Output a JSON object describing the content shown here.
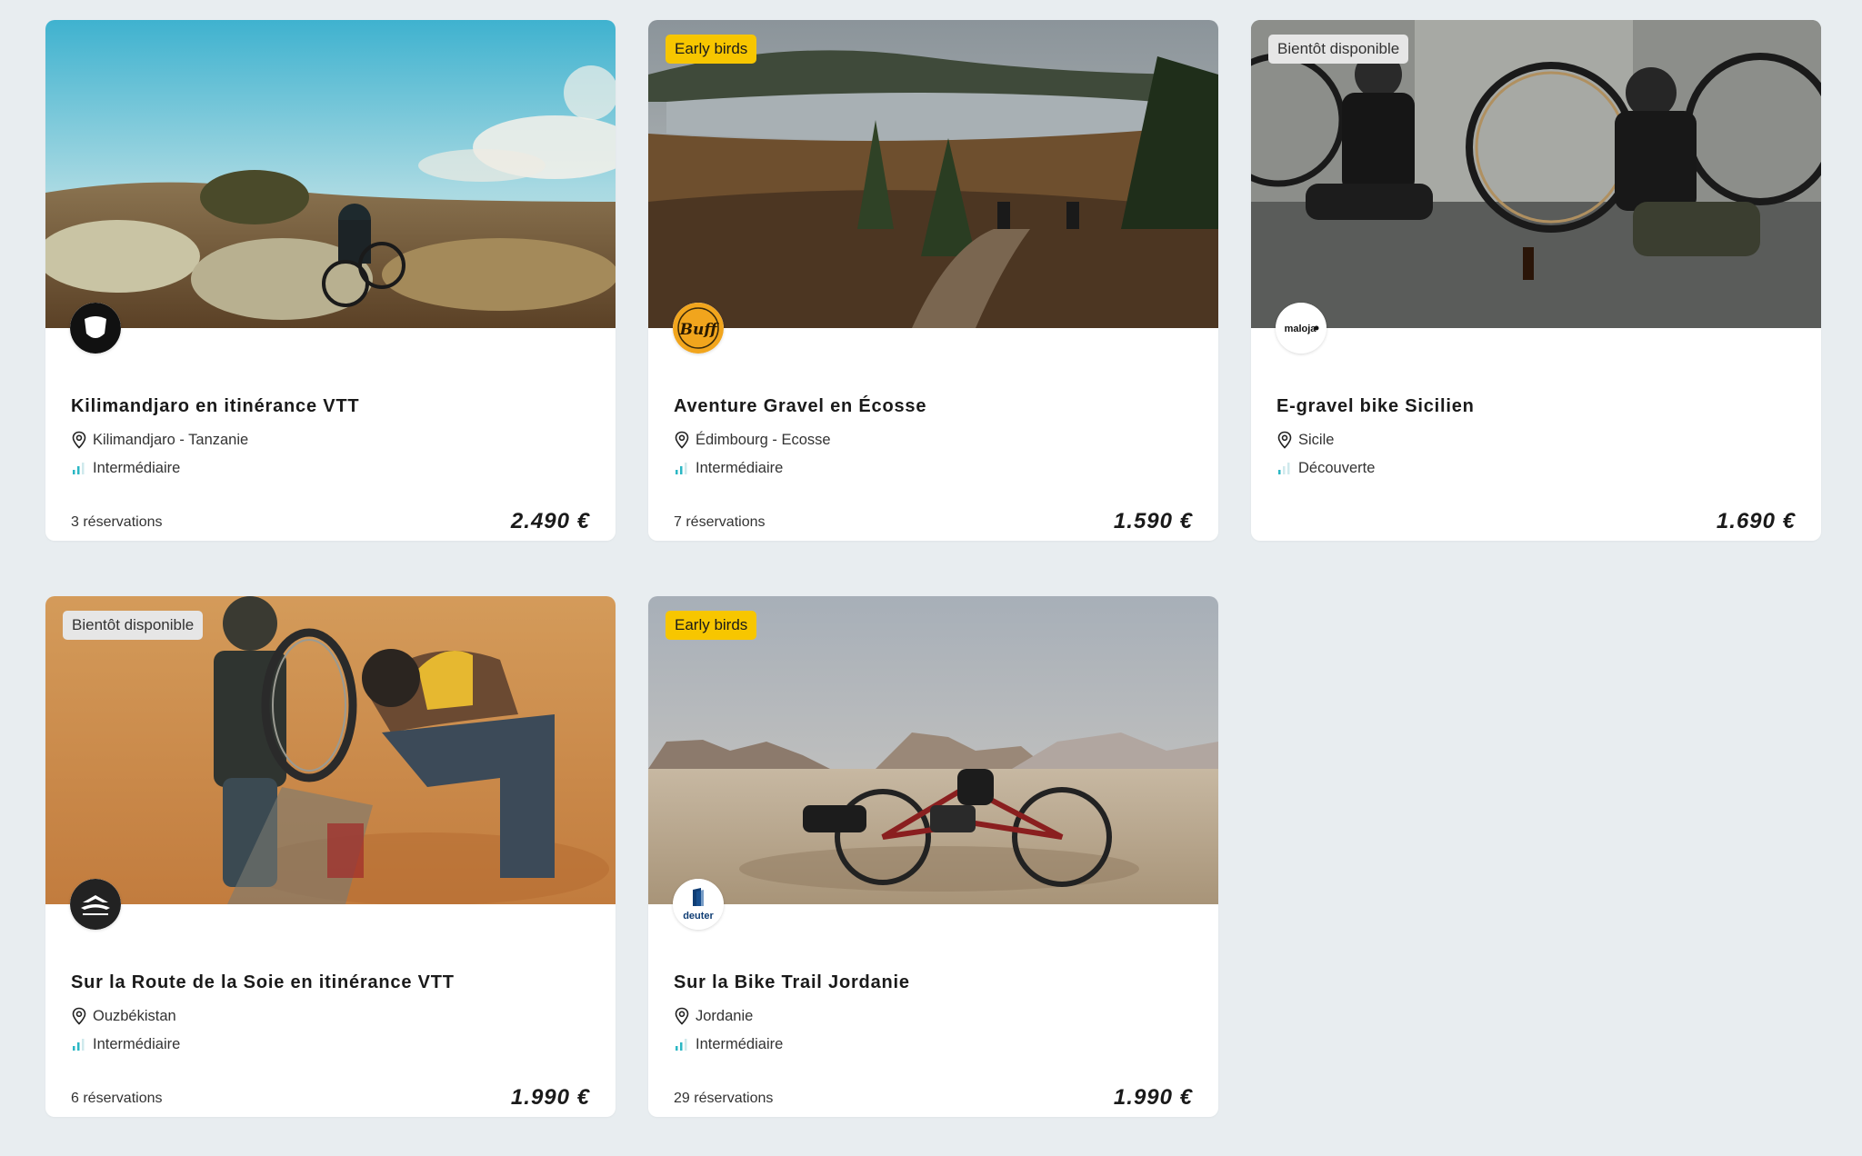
{
  "cards": [
    {
      "badge": "",
      "logo": "mountain-brand-logo",
      "title": "Kilimandjaro en itinérance VTT",
      "location": "Kilimandjaro - Tanzanie",
      "level": "Intermédiaire",
      "reservations": "3 réservations",
      "price": "2.490 €"
    },
    {
      "badge": "Early birds",
      "logo": "buff-logo",
      "logo_text": "Buff",
      "title": "Aventure Gravel en Écosse",
      "location": "Édimbourg - Ecosse",
      "level": "Intermédiaire",
      "reservations": "7 réservations",
      "price": "1.590 €"
    },
    {
      "badge": "Bientôt disponible",
      "logo": "maloja-logo",
      "logo_text": "maloja",
      "title": "E-gravel bike Sicilien",
      "location": "Sicile",
      "level": "Découverte",
      "reservations": "",
      "price": "1.690 €"
    },
    {
      "badge": "Bientôt disponible",
      "logo": "sea-to-summit-logo",
      "title": "Sur la Route de la Soie en itinérance VTT",
      "location": "Ouzbékistan",
      "level": "Intermédiaire",
      "reservations": "6 réservations",
      "price": "1.990 €"
    },
    {
      "badge": "Early birds",
      "logo": "deuter-logo",
      "logo_text": "deuter",
      "title": "Sur la Bike Trail Jordanie",
      "location": "Jordanie",
      "level": "Intermédiaire",
      "reservations": "29 réservations",
      "price": "1.990 €"
    }
  ],
  "icons": {
    "location": "map-pin-icon",
    "level": "level-bars-icon"
  },
  "colors": {
    "background": "#e8edf0",
    "card": "#ffffff",
    "early_badge": "#f7c600",
    "soon_badge": "#e6e6e6",
    "level_accent": "#2bb7c4"
  }
}
